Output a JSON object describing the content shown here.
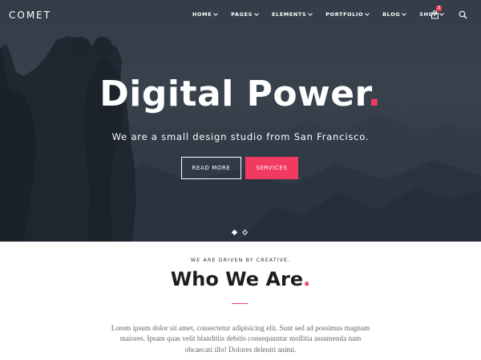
{
  "brand": {
    "logo": "COMET"
  },
  "nav": {
    "items": [
      {
        "label": "HOME"
      },
      {
        "label": "PAGES"
      },
      {
        "label": "ELEMENTS"
      },
      {
        "label": "PORTFOLIO"
      },
      {
        "label": "BLOG"
      },
      {
        "label": "SHOP"
      }
    ],
    "cart_count": "2",
    "cart_icon": "bag-icon",
    "search_icon": "search-icon"
  },
  "hero": {
    "title": "Digital Power",
    "title_dot": ".",
    "subtitle": "We are a small design studio from San Francisco.",
    "buttons": {
      "read_more": "READ MORE",
      "services": "SERVICES"
    },
    "slides": {
      "count": 2,
      "active": 1
    }
  },
  "about": {
    "kicker": "WE ARE DRIVEN BY CREATIVE.",
    "title": "Who We Are",
    "title_dot": ".",
    "text": "Lorem ipsum dolor sit amet, consectetur adipisicing elit. Sunt sed ad possimus magnam maiores. Ipsam quas velit blanditiis debitis consequuntur mollitia assumenda nam obcaecati illo! Dolores deleniti animi."
  },
  "colors": {
    "accent": "#f03a5f",
    "hero_bg": "#3b4652",
    "text_dark": "#1e1e1e",
    "text_body": "#666666"
  }
}
